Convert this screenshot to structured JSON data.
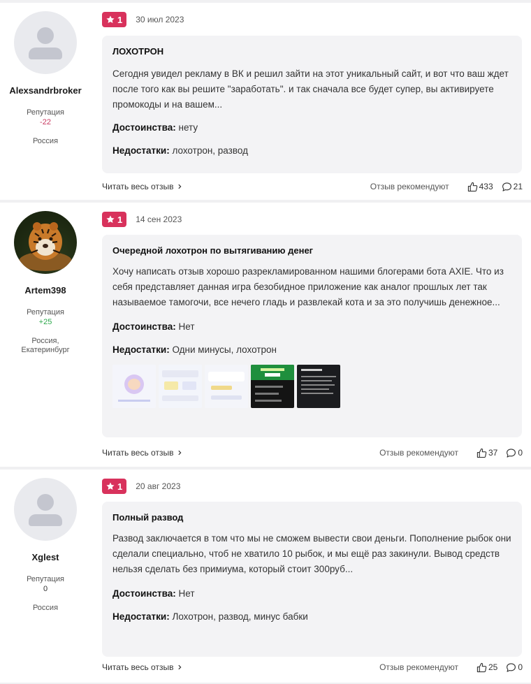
{
  "colors": {
    "rating_bg": "#d8325c",
    "card_bg": "#f3f3f5",
    "rep_negative": "#c8385f",
    "rep_positive": "#2ca84b"
  },
  "reviews": [
    {
      "author": {
        "name": "Alexsandrbroker",
        "reputation_label": "Репутация",
        "reputation": "-22",
        "location": "Россия",
        "avatar": "default-avatar"
      },
      "rating": "1",
      "date": "30 июл 2023",
      "title": "ЛОХОТРОН",
      "text": "Сегодня увидел рекламу в ВК и решил зайти на этот уникальный сайт, и вот что ваш ждет после того как вы решите \"заработать\". и так сначала все будет супер, вы активируете промокоды и на вашем...",
      "pros_label": "Достоинства:",
      "pros": "нету",
      "cons_label": "Недостатки:",
      "cons": "лохотрон, развод",
      "read_more": "Читать весь отзыв",
      "recommend_label": "Отзыв рекомендуют",
      "likes": "433",
      "comments": "21"
    },
    {
      "author": {
        "name": "Artem398",
        "reputation_label": "Репутация",
        "reputation": "+25",
        "location": "Россия, Екатеринбург",
        "avatar": "tiger-avatar"
      },
      "rating": "1",
      "date": "14 сен 2023",
      "title": "Очередной лохотрон по вытягиванию денег",
      "text": "Хочу написать отзыв хорошо разрекламированном нашими блогерами бота AXIE. Что из себя представляет данная игра безобидное приложение как аналог прошлых лет так называемое тамогочи, все нечего гладь и развлекай кота и за это получишь денежное...",
      "pros_label": "Достоинства:",
      "pros": "Нет",
      "cons_label": "Недостатки:",
      "cons": "Одни минусы, лохотрон",
      "read_more": "Читать весь отзыв",
      "recommend_label": "Отзыв рекомендуют",
      "likes": "37",
      "comments": "0",
      "thumbnails": [
        "screenshot-1",
        "screenshot-2",
        "screenshot-3",
        "screenshot-4",
        "screenshot-5"
      ]
    },
    {
      "author": {
        "name": "Xglest",
        "reputation_label": "Репутация",
        "reputation": "0",
        "location": "Россия",
        "avatar": "default-avatar"
      },
      "rating": "1",
      "date": "20 авг 2023",
      "title": "Полный развод",
      "text": "Развод заключается в том что мы не сможем вывести свои деньги. Пополнение рыбок они сделали специально, чтоб не хватило 10 рыбок, и мы ещё раз закинули. Вывод средств нельзя сделать без примиума, который стоит 300руб...",
      "pros_label": "Достоинства:",
      "pros": "Нет",
      "cons_label": "Недостатки:",
      "cons": "Лохотрон, развод, минус бабки",
      "read_more": "Читать весь отзыв",
      "recommend_label": "Отзыв рекомендуют",
      "likes": "25",
      "comments": "0"
    }
  ]
}
